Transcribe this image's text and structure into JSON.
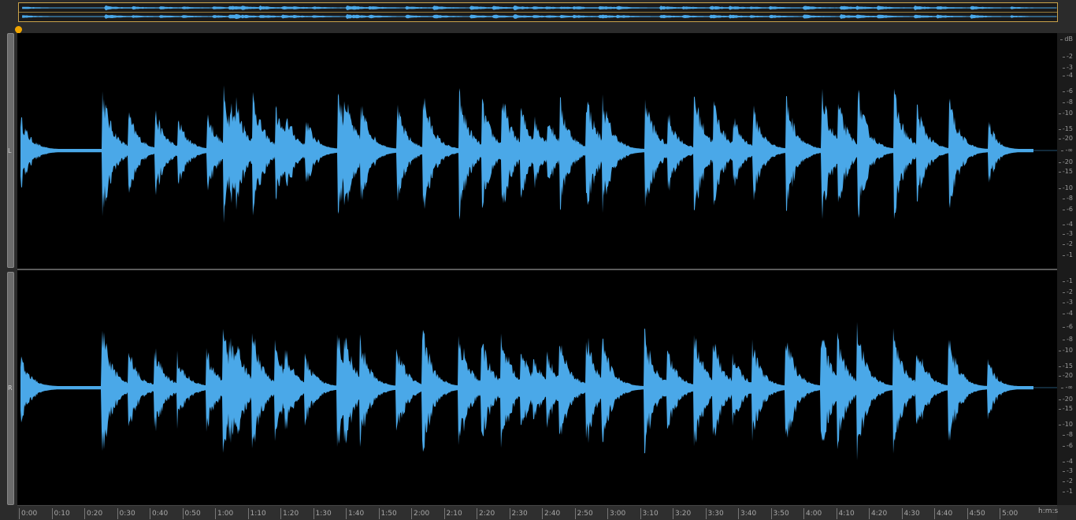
{
  "channels": [
    {
      "label": "L"
    },
    {
      "label": "R"
    }
  ],
  "db_ruler": {
    "unit": "dB",
    "upper_ticks": [
      "-2",
      "-3",
      "-4",
      "-6",
      "-8",
      "-10",
      "-15",
      "-20",
      "-∞",
      "-20",
      "-15",
      "-10",
      "-8",
      "-6",
      "-4",
      "-3",
      "-2",
      "-1"
    ],
    "lower_ticks": [
      "-1",
      "-2",
      "-3",
      "-4",
      "-6",
      "-8",
      "-10",
      "-15",
      "-20",
      "-∞",
      "-20",
      "-15",
      "-10",
      "-8",
      "-6",
      "-4",
      "-3",
      "-2",
      "-1"
    ]
  },
  "time_ruler": {
    "unit": "h:m:s",
    "ticks": [
      "0:00",
      "0:10",
      "0:20",
      "0:30",
      "0:40",
      "0:50",
      "1:00",
      "1:10",
      "1:20",
      "1:30",
      "1:40",
      "1:50",
      "2:00",
      "2:10",
      "2:20",
      "2:30",
      "2:40",
      "2:50",
      "3:00",
      "3:10",
      "3:20",
      "3:30",
      "3:40",
      "3:50",
      "4:00",
      "4:10",
      "4:20",
      "4:30",
      "4:40",
      "4:50",
      "5:00"
    ]
  },
  "colors": {
    "waveform": "#4aa8e8",
    "background": "#000000",
    "overview_border": "#c9a24a",
    "playhead": "#f0a500"
  },
  "audio": {
    "duration_seconds": 310,
    "transient_seconds": [
      0,
      25,
      33,
      41,
      48,
      57,
      62,
      64,
      66,
      71,
      78,
      81,
      87,
      97,
      99,
      104,
      115,
      123,
      134,
      141,
      147,
      153,
      157,
      161,
      165,
      173,
      178,
      191,
      198,
      206,
      212,
      218,
      224,
      234,
      245,
      250,
      256,
      267,
      274,
      284,
      296
    ]
  }
}
